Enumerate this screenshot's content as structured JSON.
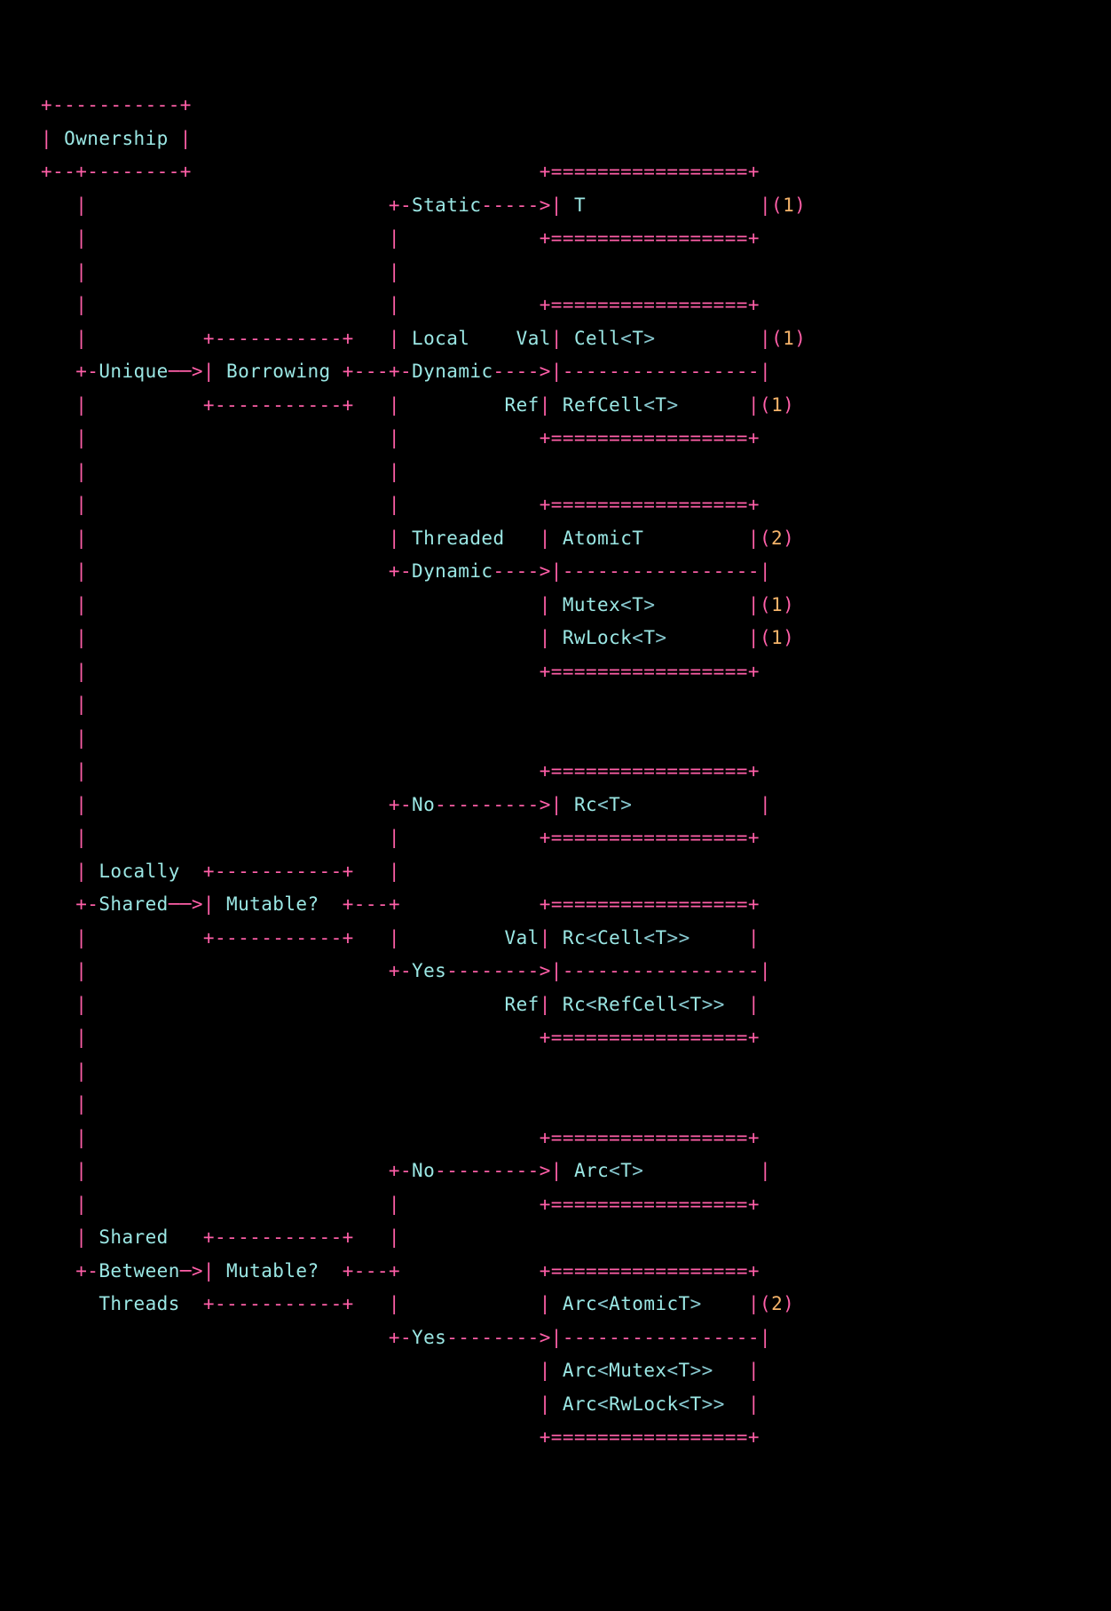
{
  "diagram": {
    "root": "Ownership",
    "branches": {
      "unique": {
        "label": "Unique",
        "node": "Borrowing",
        "options": {
          "static": {
            "label": "Static",
            "results": [
              {
                "type": "T",
                "note": "1"
              }
            ]
          },
          "local_dynamic": {
            "label_line1": "Local",
            "label_line2": "Dynamic",
            "val_label": "Val",
            "ref_label": "Ref",
            "results": [
              {
                "kind": "Val",
                "type": "Cell<T>",
                "note": "1"
              },
              {
                "kind": "Ref",
                "type": "RefCell<T>",
                "note": "1"
              }
            ]
          },
          "threaded_dynamic": {
            "label_line1": "Threaded",
            "label_line2": "Dynamic",
            "results": [
              {
                "type": "AtomicT",
                "note": "2"
              },
              {
                "type": "Mutex<T>",
                "note": "1"
              },
              {
                "type": "RwLock<T>",
                "note": "1"
              }
            ]
          }
        }
      },
      "locally_shared": {
        "label_line1": "Locally",
        "label_line2": "Shared",
        "node": "Mutable?",
        "options": {
          "no": {
            "label": "No",
            "results": [
              {
                "type": "Rc<T>"
              }
            ]
          },
          "yes": {
            "label": "Yes",
            "val_label": "Val",
            "ref_label": "Ref",
            "results": [
              {
                "kind": "Val",
                "type": "Rc<Cell<T>>"
              },
              {
                "kind": "Ref",
                "type": "Rc<RefCell<T>>"
              }
            ]
          }
        }
      },
      "shared_between_threads": {
        "label_line1": "Shared",
        "label_line2": "Between",
        "label_line3": "Threads",
        "node": "Mutable?",
        "options": {
          "no": {
            "label": "No",
            "results": [
              {
                "type": "Arc<T>"
              }
            ]
          },
          "yes": {
            "label": "Yes",
            "results": [
              {
                "type": "Arc<AtomicT>",
                "note": "2"
              },
              {
                "type": "Arc<Mutex<T>>"
              },
              {
                "type": "Arc<RwLock<T>>"
              }
            ]
          }
        }
      }
    }
  }
}
